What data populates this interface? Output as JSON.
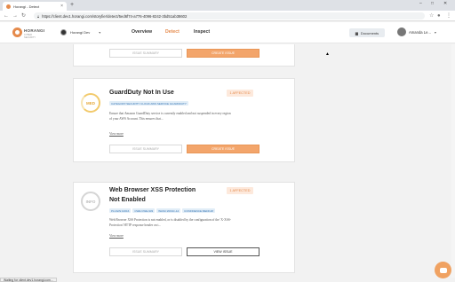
{
  "browser": {
    "tab_title": "Horangi - Detect",
    "new_tab": "+",
    "url": "https://client.dev1.horangi.com/storyfier/detect/5ed6f74-a776-4096-8242-3bd51ab38602",
    "controls": [
      "–",
      "□",
      "✕"
    ]
  },
  "header": {
    "logo_word": "HORANGI",
    "logo_tag": "CYBER SECURITY",
    "org_name": "Horangi Dev",
    "nav": [
      "Overview",
      "Detect",
      "Inspect"
    ],
    "active_nav": "Detect",
    "documents_label": "Documents",
    "user_name": "Amanda Le..."
  },
  "cards": [
    {
      "summary_label": "Issue Summary",
      "action_label": "Create Issue"
    },
    {
      "severity": "MED",
      "title": "GuardDuty Not In Use",
      "affected": "1 AFFECTED",
      "tags": [
        "CATEGORY:SECURITY CLOUD AWS SERVICE GUARDDUTY"
      ],
      "description_line1": "Ensure that Amazon GuardDuty service is currently enabled and not suspended in every region",
      "description_line2": "of your AWS Account. This ensures that...",
      "view_more": "View more",
      "summary_label": "Issue Summary",
      "action_label": "Create Issue"
    },
    {
      "severity": "INFO",
      "title_line1": "Web Browser XSS Protection",
      "title_line2": "Not Enabled",
      "affected": "1 AFFECTED",
      "tags": [
        "PLUGIN:10016",
        "CWE:CWE-933",
        "WASC:WASC-14",
        "CONFIDENCE:MEDIUM"
      ],
      "description_line1": "Web Browser XSS Protection is not enabled, or is disabled by the configuration of the 'X-XSS-",
      "description_line2": "Protection' HTTP response header on t...",
      "view_more": "View more",
      "summary_label": "Issue Summary",
      "action_label": "View Issue"
    }
  ],
  "status_bar": "Waiting for client.dev1.horangi.com..."
}
